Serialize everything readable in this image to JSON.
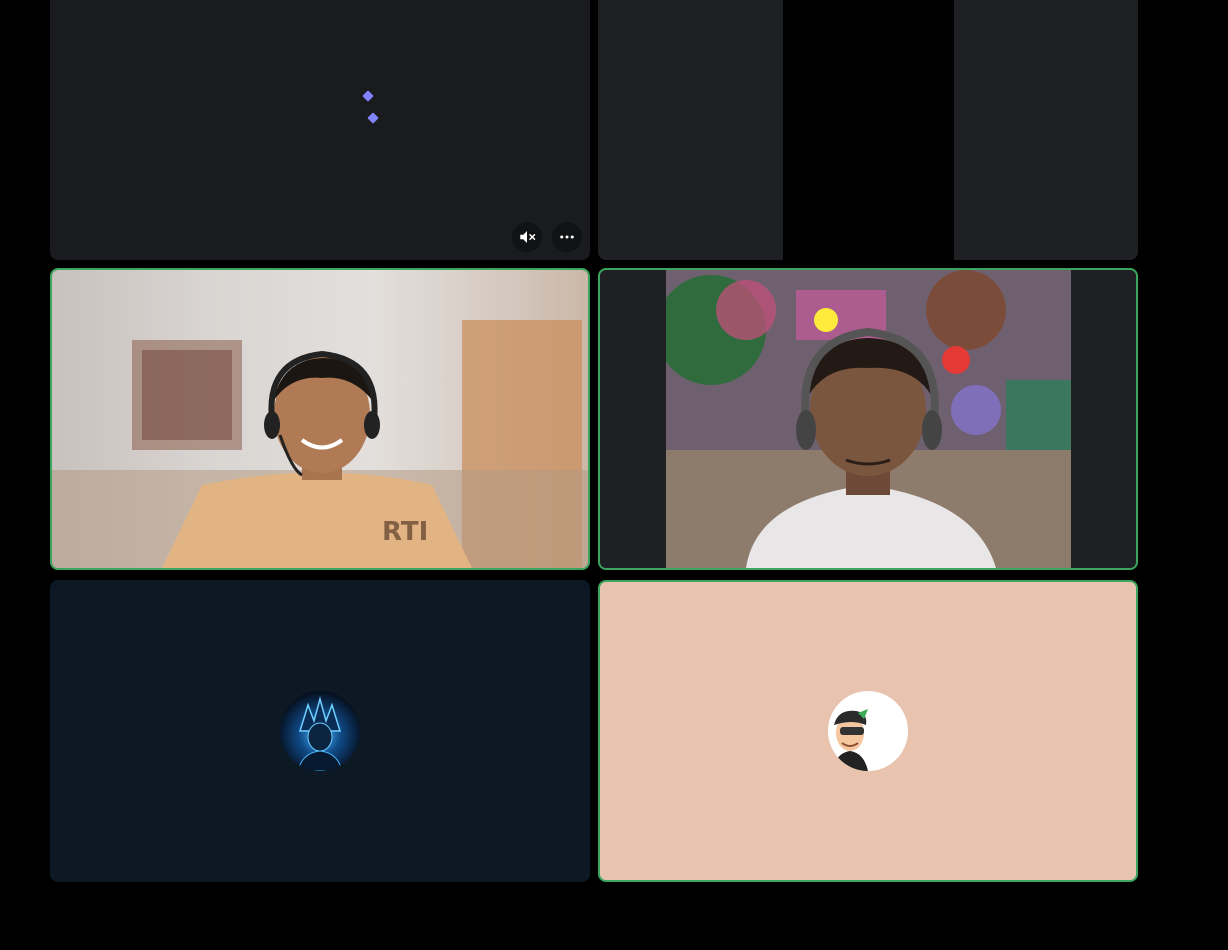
{
  "call": {
    "tiles": [
      {
        "id": "tile-1",
        "state": "loading",
        "controls": {
          "mute_icon": "speaker-muted-icon",
          "more_icon": "more-options-icon"
        }
      },
      {
        "id": "tile-2",
        "state": "stream"
      },
      {
        "id": "tile-3",
        "state": "video",
        "speaking": true
      },
      {
        "id": "tile-4",
        "state": "video",
        "speaking": true
      },
      {
        "id": "tile-5",
        "state": "avatar",
        "avatar_icon": "anime-character-avatar",
        "background": "#0c1824"
      },
      {
        "id": "tile-6",
        "state": "avatar",
        "avatar_icon": "cartoon-character-avatar",
        "background": "#e8c4af",
        "speaking": true
      }
    ],
    "colors": {
      "speaking_border": "#3ba55d",
      "loader": "#8184ff",
      "page_background": "#000000"
    }
  }
}
